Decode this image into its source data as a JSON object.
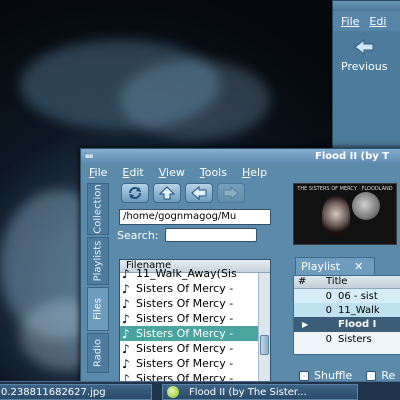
{
  "back_window": {
    "menu": [
      "File",
      "Edi"
    ],
    "previous_label": "Previous"
  },
  "main_window": {
    "title": "Flood II (by T",
    "menu": [
      "File",
      "Edit",
      "View",
      "Tools",
      "Help"
    ],
    "side_tabs": [
      "Collection",
      "Playlists",
      "Files",
      "Radio"
    ],
    "active_side_tab": "Files"
  },
  "files_panel": {
    "path": "/home/gognmagog/Mu",
    "search_label": "Search:",
    "search_value": "",
    "column_header": "Filename",
    "rows": [
      "11_Walk_Away(Sis",
      "Sisters Of Mercy -",
      "Sisters Of Mercy -",
      "Sisters Of Mercy -",
      "Sisters Of Mercy -",
      "Sisters Of Mercy -",
      "Sisters Of Mercy -",
      "Sisters Of Mercy -"
    ],
    "selected_row_index": 4
  },
  "cover": {
    "title": "THE SISTERS OF MERCY · FLOODLAND"
  },
  "playlist": {
    "tab_label": "Playlist",
    "close_glyph": "✕",
    "columns": [
      "#",
      "Title"
    ],
    "rows": [
      {
        "num": "0",
        "title": "06 - sist"
      },
      {
        "num": "0",
        "title": "11_Walk"
      }
    ],
    "group_label": "Flood I",
    "group_rows": [
      {
        "num": "0",
        "title": "Sisters"
      }
    ],
    "shuffle_label": "Shuffle",
    "repeat_label": "Re"
  },
  "taskbar": {
    "items": [
      "0.238811682627.jpg",
      "Flood II (by The Sister..."
    ]
  },
  "colors": {
    "window_bg": "#5b8aaa",
    "selection": "#4aa5a0",
    "taskbar": "#1f344a"
  }
}
